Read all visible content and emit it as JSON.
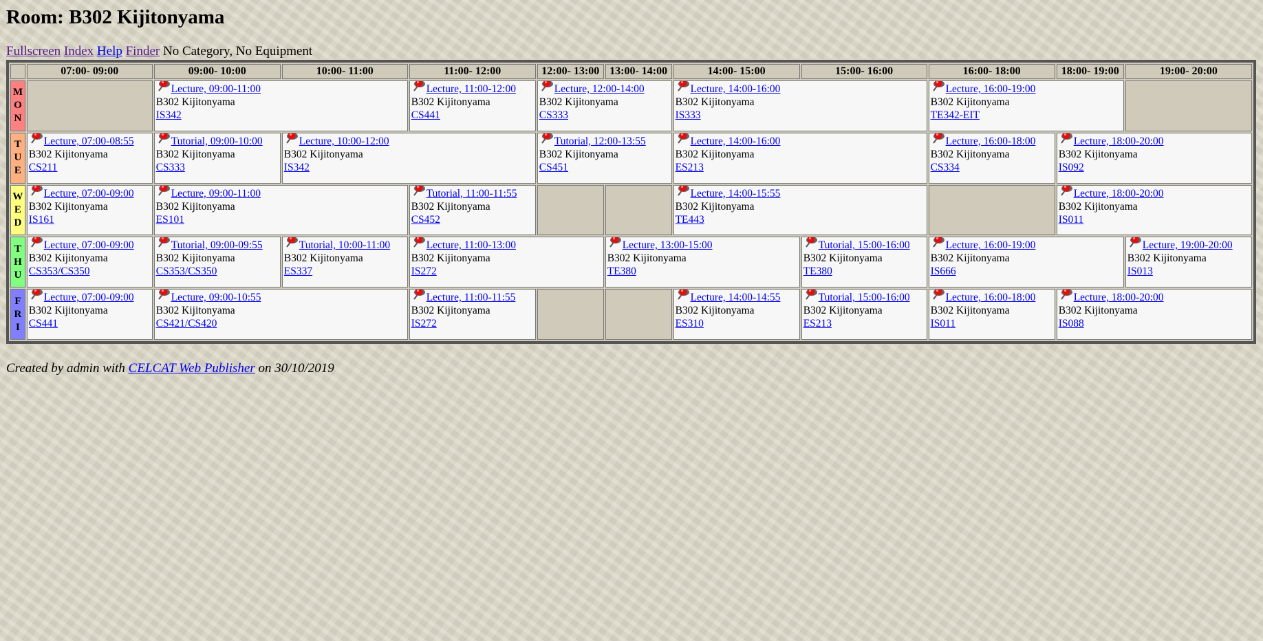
{
  "title": "Room: B302 Kijitonyama",
  "nav": {
    "fullscreen": "Fullscreen",
    "index": "Index",
    "help": "Help",
    "finder": "Finder",
    "filter": "No Category, No Equipment"
  },
  "headers": [
    "07:00- 09:00",
    "09:00- 10:00",
    "10:00- 11:00",
    "11:00- 12:00",
    "12:00- 13:00",
    "13:00- 14:00",
    "14:00- 15:00",
    "15:00- 16:00",
    "16:00- 18:00",
    "18:00- 19:00",
    "19:00- 20:00"
  ],
  "room": "B302 Kijitonyama",
  "days": [
    {
      "label": "MON",
      "color": "#ff8080",
      "cells": [
        {
          "empty": true,
          "span": 1
        },
        {
          "span": 2,
          "event": "Lecture, 09:00-11:00",
          "course": "IS342"
        },
        {
          "span": 1,
          "event": "Lecture, 11:00-12:00",
          "course": "CS441"
        },
        {
          "span": 2,
          "event": "Lecture, 12:00-14:00",
          "course": "CS333"
        },
        {
          "span": 2,
          "event": "Lecture, 14:00-16:00",
          "course": "IS333"
        },
        {
          "span": 2,
          "event": "Lecture, 16:00-19:00",
          "course": "TE342-EIT"
        },
        {
          "empty": true,
          "span": 1
        }
      ]
    },
    {
      "label": "TUE",
      "color": "#ffb080",
      "cells": [
        {
          "span": 1,
          "event": "Lecture, 07:00-08:55",
          "course": "CS211"
        },
        {
          "span": 1,
          "event": "Tutorial, 09:00-10:00",
          "course": "CS333"
        },
        {
          "span": 2,
          "event": "Lecture, 10:00-12:00",
          "course": "IS342"
        },
        {
          "span": 2,
          "event": "Tutorial, 12:00-13:55",
          "course": "CS451"
        },
        {
          "span": 2,
          "event": "Lecture, 14:00-16:00",
          "course": "ES213"
        },
        {
          "span": 1,
          "event": "Lecture, 16:00-18:00",
          "course": "CS334"
        },
        {
          "span": 2,
          "event": "Lecture, 18:00-20:00",
          "course": "IS092"
        }
      ]
    },
    {
      "label": "WED",
      "color": "#ffff80",
      "cells": [
        {
          "span": 1,
          "event": "Lecture, 07:00-09:00",
          "course": "IS161"
        },
        {
          "span": 2,
          "event": "Lecture, 09:00-11:00",
          "course": "ES101"
        },
        {
          "span": 1,
          "event": "Tutorial, 11:00-11:55",
          "course": "CS452"
        },
        {
          "empty": true,
          "span": 1
        },
        {
          "empty": true,
          "span": 1
        },
        {
          "span": 2,
          "event": "Lecture, 14:00-15:55",
          "course": "TE443"
        },
        {
          "empty": true,
          "span": 1
        },
        {
          "span": 2,
          "event": "Lecture, 18:00-20:00",
          "course": "IS011"
        }
      ]
    },
    {
      "label": "THU",
      "color": "#80ff80",
      "cells": [
        {
          "span": 1,
          "event": "Lecture, 07:00-09:00",
          "course": "CS353/CS350"
        },
        {
          "span": 1,
          "event": "Tutorial, 09:00-09:55",
          "course": "CS353/CS350"
        },
        {
          "span": 1,
          "event": "Tutorial, 10:00-11:00",
          "course": "ES337"
        },
        {
          "span": 2,
          "event": "Lecture, 11:00-13:00",
          "course": "IS272"
        },
        {
          "span": 2,
          "event": "Lecture, 13:00-15:00",
          "course": "TE380"
        },
        {
          "span": 1,
          "event": "Tutorial, 15:00-16:00",
          "course": "TE380"
        },
        {
          "span": 2,
          "event": "Lecture, 16:00-19:00",
          "course": "IS666"
        },
        {
          "span": 1,
          "event": "Lecture, 19:00-20:00",
          "course": "IS013"
        }
      ]
    },
    {
      "label": "FRI",
      "color": "#8080ff",
      "cells": [
        {
          "span": 1,
          "event": "Lecture, 07:00-09:00",
          "course": "CS441"
        },
        {
          "span": 2,
          "event": "Lecture, 09:00-10:55",
          "course": "CS421/CS420"
        },
        {
          "span": 1,
          "event": "Lecture, 11:00-11:55",
          "course": "IS272"
        },
        {
          "empty": true,
          "span": 1
        },
        {
          "empty": true,
          "span": 1
        },
        {
          "span": 1,
          "event": "Lecture, 14:00-14:55",
          "course": "ES310"
        },
        {
          "span": 1,
          "event": "Tutorial, 15:00-16:00",
          "course": "ES213"
        },
        {
          "span": 1,
          "event": "Lecture, 16:00-18:00",
          "course": "IS011"
        },
        {
          "span": 2,
          "event": "Lecture, 18:00-20:00",
          "course": "IS088"
        }
      ]
    }
  ],
  "footer": {
    "prefix": "Created by admin with",
    "link": "CELCAT Web Publisher",
    "suffix": "on 30/10/2019"
  }
}
